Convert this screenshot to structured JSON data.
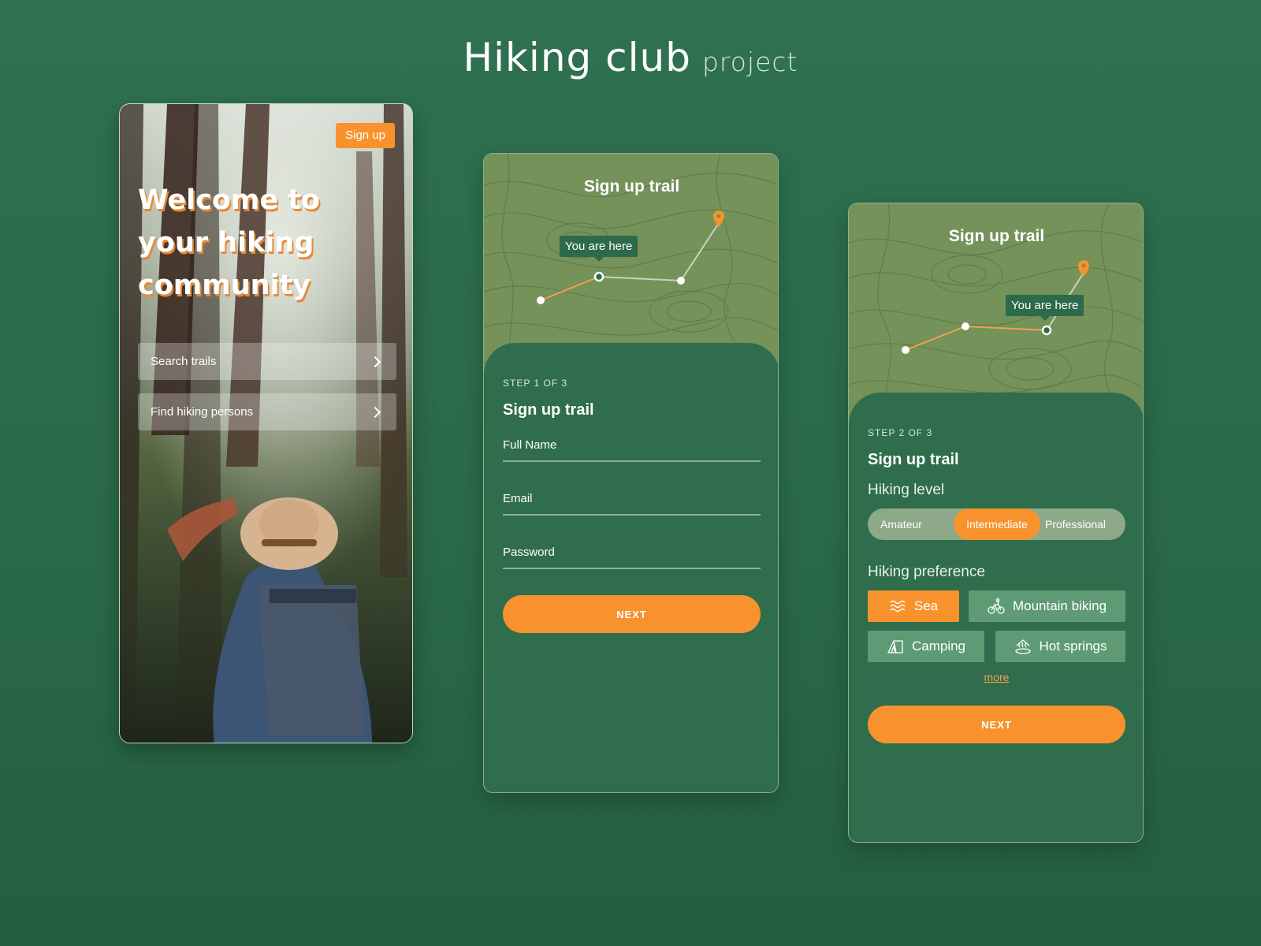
{
  "page": {
    "title": "Hiking club",
    "subtitle": "project"
  },
  "colors": {
    "background": "#2b6d4b",
    "accent": "#f7922d",
    "map": "#74925a",
    "chip": "#5e9a73"
  },
  "home": {
    "signup_label": "Sign up",
    "welcome_lines": [
      "Welcome to",
      "your hiking",
      "community"
    ],
    "buttons": [
      {
        "label": "Search trails",
        "icon": "chevron-right-icon"
      },
      {
        "label": "Find hiking persons",
        "icon": "chevron-right-icon"
      }
    ]
  },
  "step1": {
    "map_title": "Sign up trail",
    "marker_label": "You are here",
    "step_text": "STEP 1 OF 3",
    "title": "Sign up trail",
    "fields": [
      "Full Name",
      "Email",
      "Password"
    ],
    "next_label": "NEXT"
  },
  "step2": {
    "map_title": "Sign up trail",
    "marker_label": "You are here",
    "step_text": "STEP 2 OF 3",
    "title": "Sign up trail",
    "level_label": "Hiking level",
    "levels": [
      "Amateur",
      "Intermediate",
      "Professional"
    ],
    "selected_level": "Intermediate",
    "preference_label": "Hiking preference",
    "preferences": [
      {
        "label": "Sea",
        "icon": "waves-icon",
        "selected": true
      },
      {
        "label": "Mountain biking",
        "icon": "bike-icon",
        "selected": false
      },
      {
        "label": "Camping",
        "icon": "tent-icon",
        "selected": false
      },
      {
        "label": "Hot springs",
        "icon": "hot-springs-icon",
        "selected": false
      }
    ],
    "more_label": "more",
    "next_label": "NEXT"
  }
}
